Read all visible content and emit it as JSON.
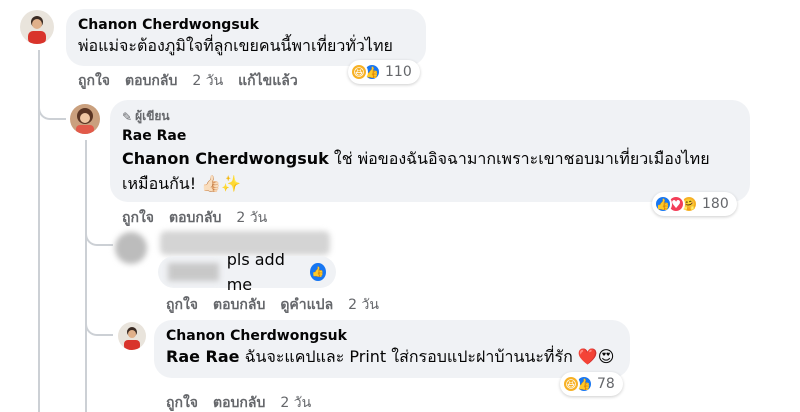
{
  "comment1": {
    "author": "Chanon Cherdwongsuk",
    "text": "พ่อแม่จะต้องภูมิใจที่ลูกเขยคนนี้พาเที่ยวทั่วไทย",
    "actions": {
      "like": "ถูกใจ",
      "reply": "ตอบกลับ",
      "time": "2 วัน",
      "edited": "แก้ไขแล้ว"
    },
    "reactions": {
      "icons": [
        "haha-icon",
        "like-icon"
      ],
      "count": "110"
    }
  },
  "reply1": {
    "badge": "ผู้เขียน",
    "author": "Rae Rae",
    "mention": "Chanon Cherdwongsuk",
    "text_line1": "ใช่ พ่อของฉันอิจฉามากเพราะเขาชอบมาเที่ยวเมืองไทย",
    "text_line2": "เหมือนกัน! 👍🏻✨",
    "actions": {
      "like": "ถูกใจ",
      "reply": "ตอบกลับ",
      "time": "2 วัน"
    },
    "reactions": {
      "icons": [
        "like-icon",
        "love-icon",
        "care-icon"
      ],
      "count": "180"
    }
  },
  "reply2": {
    "text": "pls add me",
    "actions": {
      "like": "ถูกใจ",
      "reply": "ตอบกลับ",
      "translate": "ดูคำแปล",
      "time": "2 วัน"
    }
  },
  "reply3": {
    "author": "Chanon Cherdwongsuk",
    "mention": "Rae Rae",
    "text": "ฉันจะแคปและ Print ใส่กรอบแปะฝาบ้านนะที่รัก ❤️😍",
    "actions": {
      "like": "ถูกใจ",
      "reply": "ตอบกลับ",
      "time": "2 วัน"
    },
    "reactions": {
      "icons": [
        "haha-icon",
        "like-icon"
      ],
      "count": "78"
    }
  },
  "colors": {
    "bubble": "#f0f2f5",
    "secondary_text": "#65676b",
    "like_blue": "#1877f2",
    "love_red": "#f33e58",
    "haha_yellow": "#f7b125"
  }
}
